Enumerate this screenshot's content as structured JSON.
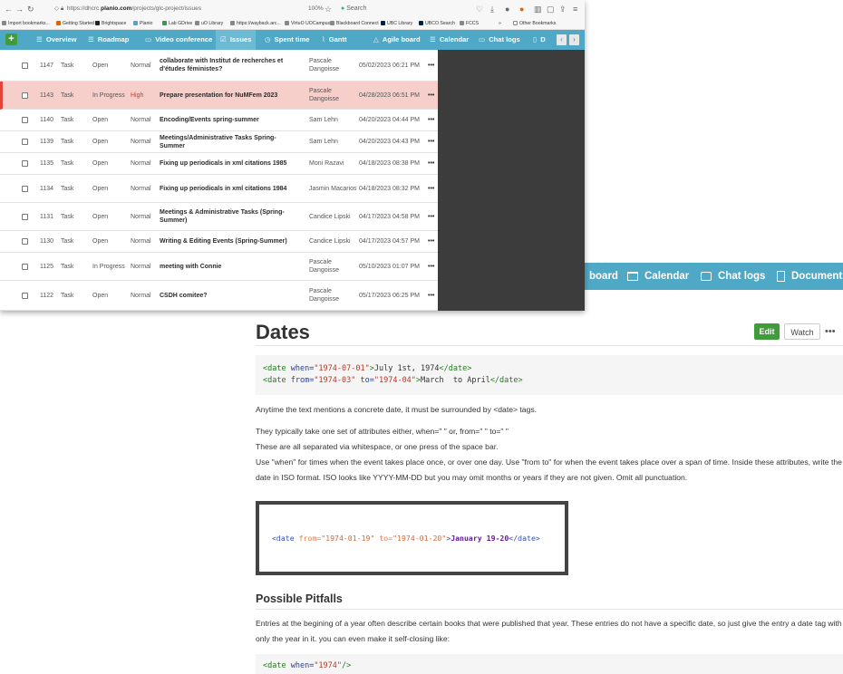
{
  "browser": {
    "url_prefix": "https://dhcrc.",
    "url_domain": "planio.com",
    "url_path": "/projects/glc-project/issues",
    "zoom": "100%",
    "search_placeholder": "Search"
  },
  "bookmarks": [
    {
      "label": "Import bookmarks...",
      "color": "#888888"
    },
    {
      "label": "Getting Started",
      "color": "#e66000"
    },
    {
      "label": "Brightspace",
      "color": "#222222"
    },
    {
      "label": "Planio",
      "color": "#4fa8c5"
    },
    {
      "label": "Lab GDrive",
      "color": "#2f9e44"
    },
    {
      "label": "uO Library",
      "color": "#888888"
    },
    {
      "label": "https://wayback.arc...",
      "color": "#888888"
    },
    {
      "label": "VirtuO UOCampus",
      "color": "#888888"
    },
    {
      "label": "Blackboard Connect",
      "color": "#888888"
    },
    {
      "label": "UBC Library",
      "color": "#002145"
    },
    {
      "label": "UBCO Search",
      "color": "#002145"
    },
    {
      "label": "FCCS",
      "color": "#888888"
    }
  ],
  "bookmarks_more": "»",
  "other_bookmarks": "Other Bookmarks",
  "app_nav": {
    "plus": "+",
    "items": [
      {
        "label": "Overview",
        "symbol": "☰"
      },
      {
        "label": "Roadmap",
        "symbol": "☰"
      },
      {
        "label": "Video conference",
        "symbol": "▭"
      },
      {
        "label": "Issues",
        "symbol": "☑"
      },
      {
        "label": "Spent time",
        "symbol": "◷"
      },
      {
        "label": "Gantt",
        "symbol": "⌇"
      },
      {
        "label": "Agile board",
        "symbol": "△"
      },
      {
        "label": "Calendar",
        "symbol": "☰"
      },
      {
        "label": "Chat logs",
        "symbol": "▭"
      },
      {
        "label": "D",
        "symbol": "▯"
      }
    ],
    "active": "Issues",
    "prev": "‹",
    "next": "›"
  },
  "issues": [
    {
      "id": "1147",
      "tracker": "Task",
      "status": "Open",
      "priority": "Normal",
      "subject": "collaborate with Institut de recherches et d'études féministes?",
      "assignee": "Pascale Dangoisse",
      "updated": "05/02/2023 06:21 PM",
      "highlight": false
    },
    {
      "id": "1143",
      "tracker": "Task",
      "status": "In Progress",
      "priority": "High",
      "subject": "Prepare presentation for NuMFem 2023",
      "assignee": "Pascale Dangoisse",
      "updated": "04/28/2023 06:51 PM",
      "highlight": true
    },
    {
      "id": "1140",
      "tracker": "Task",
      "status": "Open",
      "priority": "Normal",
      "subject": "Encoding/Events spring-summer",
      "assignee": "Sam Lehn",
      "updated": "04/20/2023 04:44 PM",
      "highlight": false
    },
    {
      "id": "1139",
      "tracker": "Task",
      "status": "Open",
      "priority": "Normal",
      "subject": "Meetings/Administrative Tasks Spring-Summer",
      "assignee": "Sam Lehn",
      "updated": "04/20/2023 04:43 PM",
      "highlight": false
    },
    {
      "id": "1135",
      "tracker": "Task",
      "status": "Open",
      "priority": "Normal",
      "subject": "Fixing up periodicals in xml citations 1985",
      "assignee": "Moni Razavi",
      "updated": "04/18/2023 08:38 PM",
      "highlight": false
    },
    {
      "id": "1134",
      "tracker": "Task",
      "status": "Open",
      "priority": "Normal",
      "subject": "Fixing up periodicals in xml citations 1984",
      "assignee": "Jasmin Macarios",
      "updated": "04/18/2023 08:32 PM",
      "highlight": false
    },
    {
      "id": "1131",
      "tracker": "Task",
      "status": "Open",
      "priority": "Normal",
      "subject": "Meetings & Administrative Tasks (Spring-Summer)",
      "assignee": "Candice Lipski",
      "updated": "04/17/2023 04:58 PM",
      "highlight": false
    },
    {
      "id": "1130",
      "tracker": "Task",
      "status": "Open",
      "priority": "Normal",
      "subject": "Writing & Editing Events (Spring-Summer)",
      "assignee": "Candice Lipski",
      "updated": "04/17/2023 04:57 PM",
      "highlight": false
    },
    {
      "id": "1125",
      "tracker": "Task",
      "status": "In Progress",
      "priority": "Normal",
      "subject": "meeting with Connie",
      "assignee": "Pascale Dangoisse",
      "updated": "05/10/2023 01:07 PM",
      "highlight": false
    },
    {
      "id": "1122",
      "tracker": "Task",
      "status": "Open",
      "priority": "Normal",
      "subject": "CSDH comitee?",
      "assignee": "Pascale Dangoisse",
      "updated": "05/17/2023 06:25 PM",
      "highlight": false
    }
  ],
  "row_menu": "•••",
  "wiki_nav": {
    "board": "board",
    "calendar": "Calendar",
    "chat_logs": "Chat logs",
    "documents": "Documents"
  },
  "wiki": {
    "title": "Dates",
    "edit": "Edit",
    "watch": "Watch",
    "more": "•••",
    "code1": {
      "line1_open": "<date ",
      "line1_attr": "when=",
      "line1_val": "\"1974-07-01\"",
      "line1_gt": ">",
      "line1_text": "July 1st, 1974",
      "line1_close": "</date>",
      "line2_open": "<date ",
      "line2_attr1": "from=",
      "line2_val1": "\"1974-03\"",
      "line2_attr2": " to=",
      "line2_val2": "\"1974-04\"",
      "line2_gt": ">",
      "line2_text": "March  to April",
      "line2_close": "</date>"
    },
    "p1": "Anytime the text mentions a concrete date, it must be surrounded by <date> tags.",
    "p2": "They typically take one set of attributes either, when=\" \" or, from=\" \" to=\" \"",
    "p3": "These are all separated via whitespace, or one press of the space bar.",
    "p4": "Use \"when\" for times when the event takes place once, or over one day. Use \"from to\" for when the event takes place over a span of time. Inside these attributes, write the date in ISO format. ISO looks like YYYY-MM-DD but you may omit months or years if they are not given. Omit all punctuation.",
    "code_img": {
      "open": "<date ",
      "attr1": "from=",
      "val1": "\"1974-01-19\"",
      "attr2": " to=",
      "val2": "\"1974-01-20\"",
      "gt": ">",
      "text": "January 19-20",
      "close": "</date>"
    },
    "h2": "Possible Pitfalls",
    "p5": "Entries at the begining of a year often describe certain books that were published that year. These entries do not have a specific date, so just give the entry a date tag with only the year in it. you can even make it self-closing like:",
    "code2": {
      "open": "<date ",
      "attr": "when=",
      "val": "\"1974\"",
      "close": "/>"
    }
  }
}
